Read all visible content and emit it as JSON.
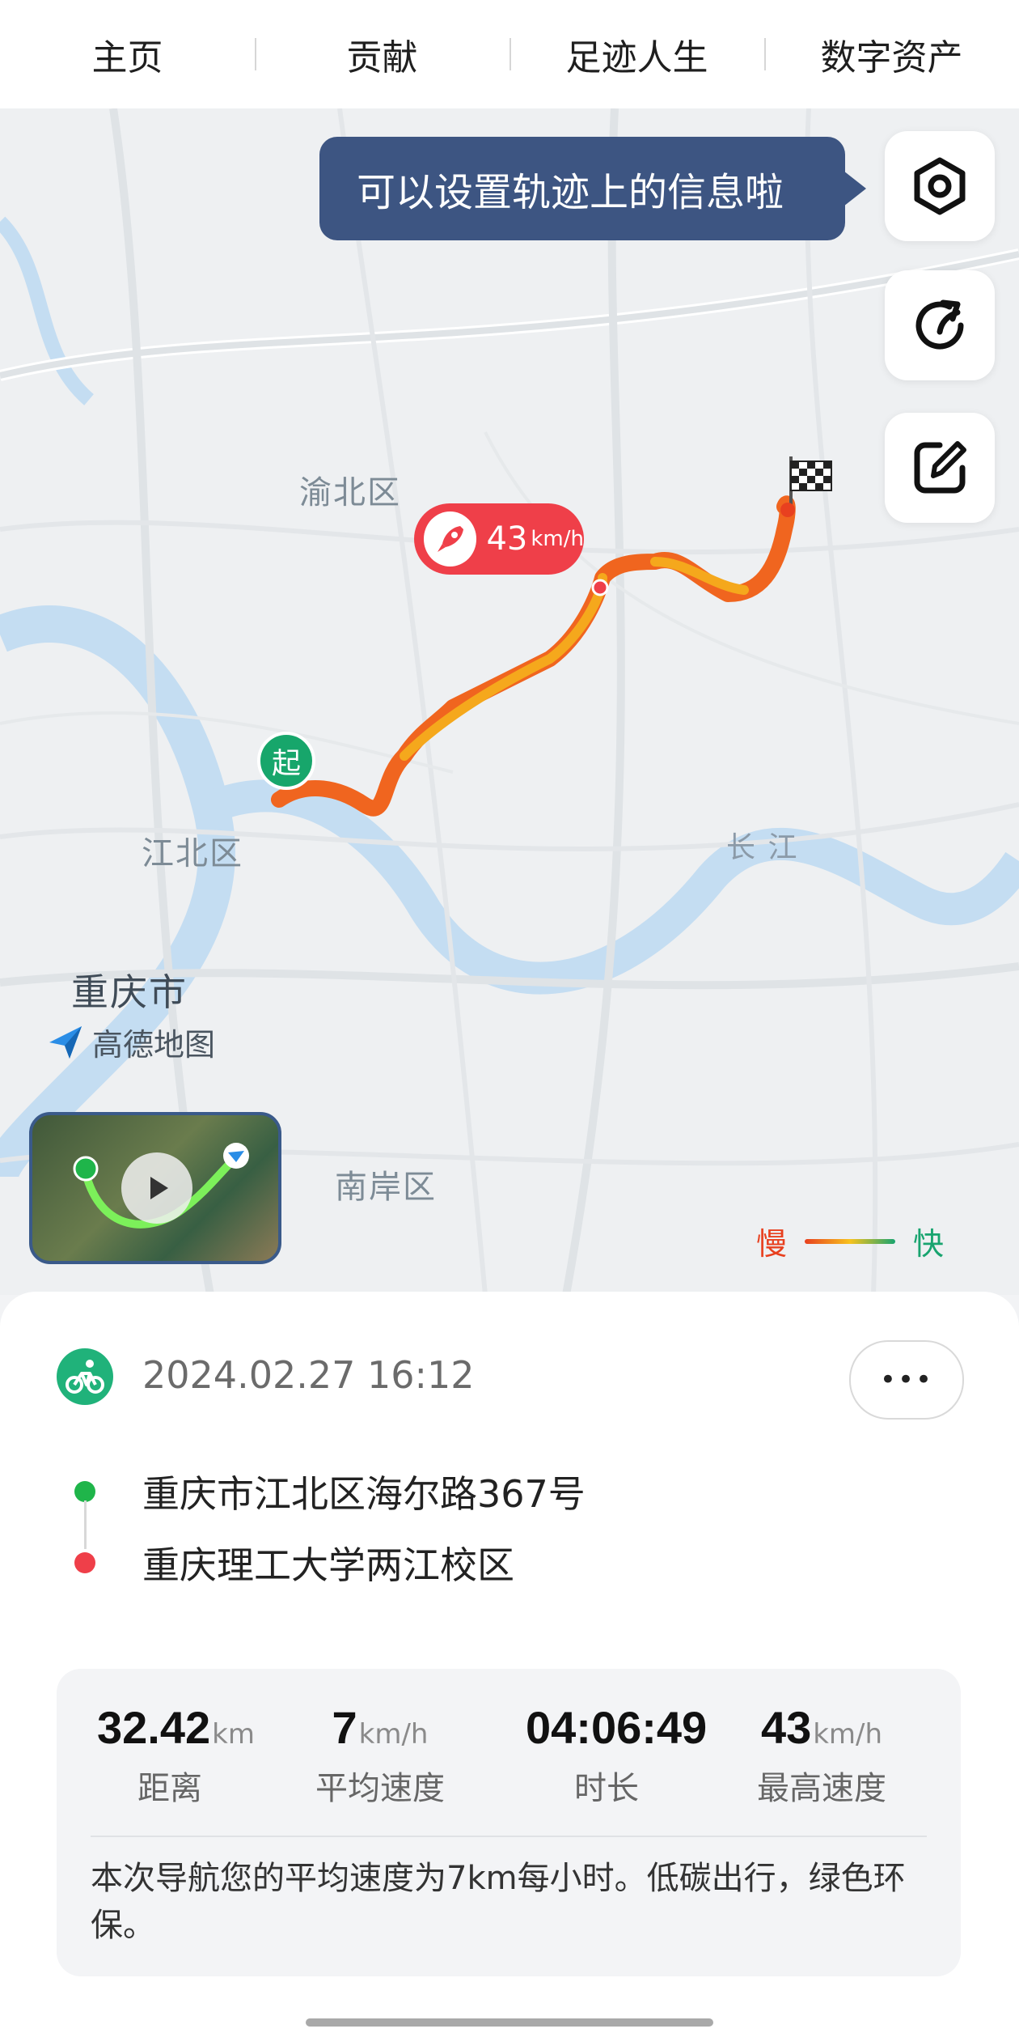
{
  "nav": {
    "tabs": [
      "主页",
      "贡献",
      "足迹人生",
      "数字资产"
    ]
  },
  "map": {
    "tooltip": "可以设置轨迹上的信息啦",
    "speed_bubble": {
      "value": "43",
      "unit": "km/h"
    },
    "start_marker": "起",
    "labels": {
      "yubei": "渝北区",
      "jiangbei": "江北区",
      "chongqing": "重庆市",
      "nanan": "南岸区",
      "changjiang": "长 江"
    },
    "provider": "高德地图",
    "legend": {
      "slow": "慢",
      "fast": "快"
    },
    "buttons": [
      "settings-icon",
      "share-icon",
      "edit-icon"
    ],
    "colors": {
      "route_slow": "#e8401f",
      "route_fast": "#f7c21e",
      "legend_fast": "#18a46f"
    }
  },
  "trip": {
    "datetime": "2024.02.27 16:12",
    "more_label": "•••",
    "start_address": "重庆市江北区海尔路367号",
    "end_address": "重庆理工大学两江校区",
    "start_color": "#1fb54a",
    "end_color": "#ef3f49"
  },
  "stats": {
    "distance": {
      "value": "32.42",
      "unit": "km",
      "label": "距离"
    },
    "avg_speed": {
      "value": "7",
      "unit": "km/h",
      "label": "平均速度"
    },
    "duration": {
      "value": "04:06:49",
      "unit": "",
      "label": "时长"
    },
    "max_speed": {
      "value": "43",
      "unit": "km/h",
      "label": "最高速度"
    },
    "summary": "本次导航您的平均速度为7km每小时。低碳出行，绿色环保。"
  }
}
